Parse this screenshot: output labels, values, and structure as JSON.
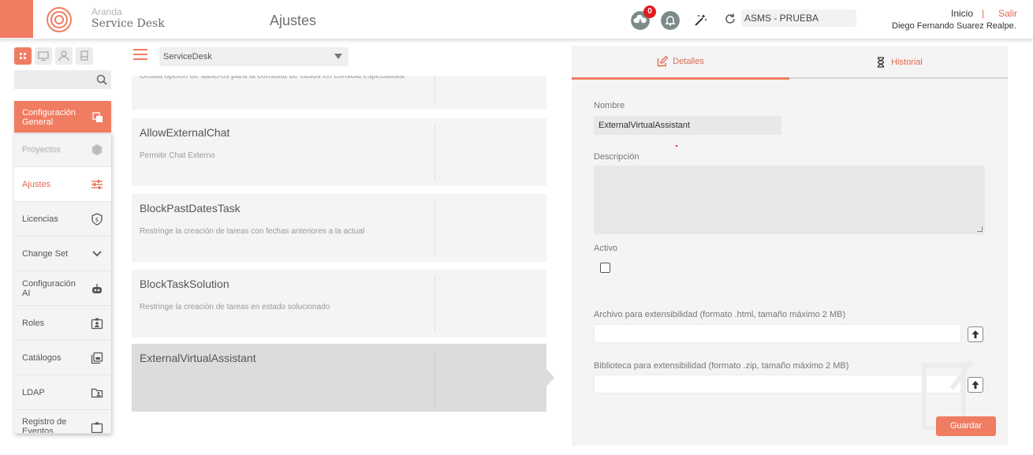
{
  "app": {
    "brand_line1": "Aranda",
    "brand_line2": "Service Desk",
    "page_title": "Ajustes"
  },
  "header": {
    "notification_count": "0",
    "environment": "ASMS - PRUEBA",
    "home_link": "Inicio",
    "separator": "|",
    "logout_link": "Salir",
    "user_name": "Diego Fernando Suarez Realpe."
  },
  "sidebar": {
    "active_group": "Configuración General",
    "items": [
      {
        "label": "Proyectos",
        "icon": "hexagon-icon"
      },
      {
        "label": "Ajustes",
        "icon": "sliders-icon"
      },
      {
        "label": "Licencias",
        "icon": "shield-icon"
      },
      {
        "label": "Change Set",
        "icon": "chevron-down-icon"
      },
      {
        "label": "Configuración AI",
        "icon": "robot-icon"
      },
      {
        "label": "Roles",
        "icon": "id-badge-icon"
      },
      {
        "label": "Catálogos",
        "icon": "catalog-icon"
      },
      {
        "label": "LDAP",
        "icon": "folder-user-icon"
      },
      {
        "label": "Registro de Eventos",
        "icon": "register-icon"
      }
    ]
  },
  "list": {
    "project_select": "ServiceDesk",
    "cards": [
      {
        "title": "",
        "desc": "Oculta opción de tableros para la consulta de casos en consola especialista"
      },
      {
        "title": "AllowExternalChat",
        "desc": "Permitir Chat Externo"
      },
      {
        "title": "BlockPastDatesTask",
        "desc": "Restringe la creación de tareas con fechas anteriores a la actual"
      },
      {
        "title": "BlockTaskSolution",
        "desc": "Restringe la creación de tareas en estado solucionado"
      },
      {
        "title": "ExternalVirtualAssistant",
        "desc": ""
      }
    ]
  },
  "detail": {
    "tab_details": "Detalles",
    "tab_history": "Historial",
    "name_label": "Nombre",
    "name_value": "ExternalVirtualAssistant",
    "description_label": "Descripción",
    "description_value": "",
    "active_label": "Activo",
    "file_label": "Archivo para extensibilidad (formato .html, tamaño máximo 2 MB)",
    "library_label": "Biblioteca para extensibilidad (formato .zip, tamaño máximo 2 MB)",
    "save_label": "Guardar"
  },
  "colors": {
    "accent": "#f07c62",
    "accent_text": "#e06a50",
    "badge": "#e01b1b"
  }
}
